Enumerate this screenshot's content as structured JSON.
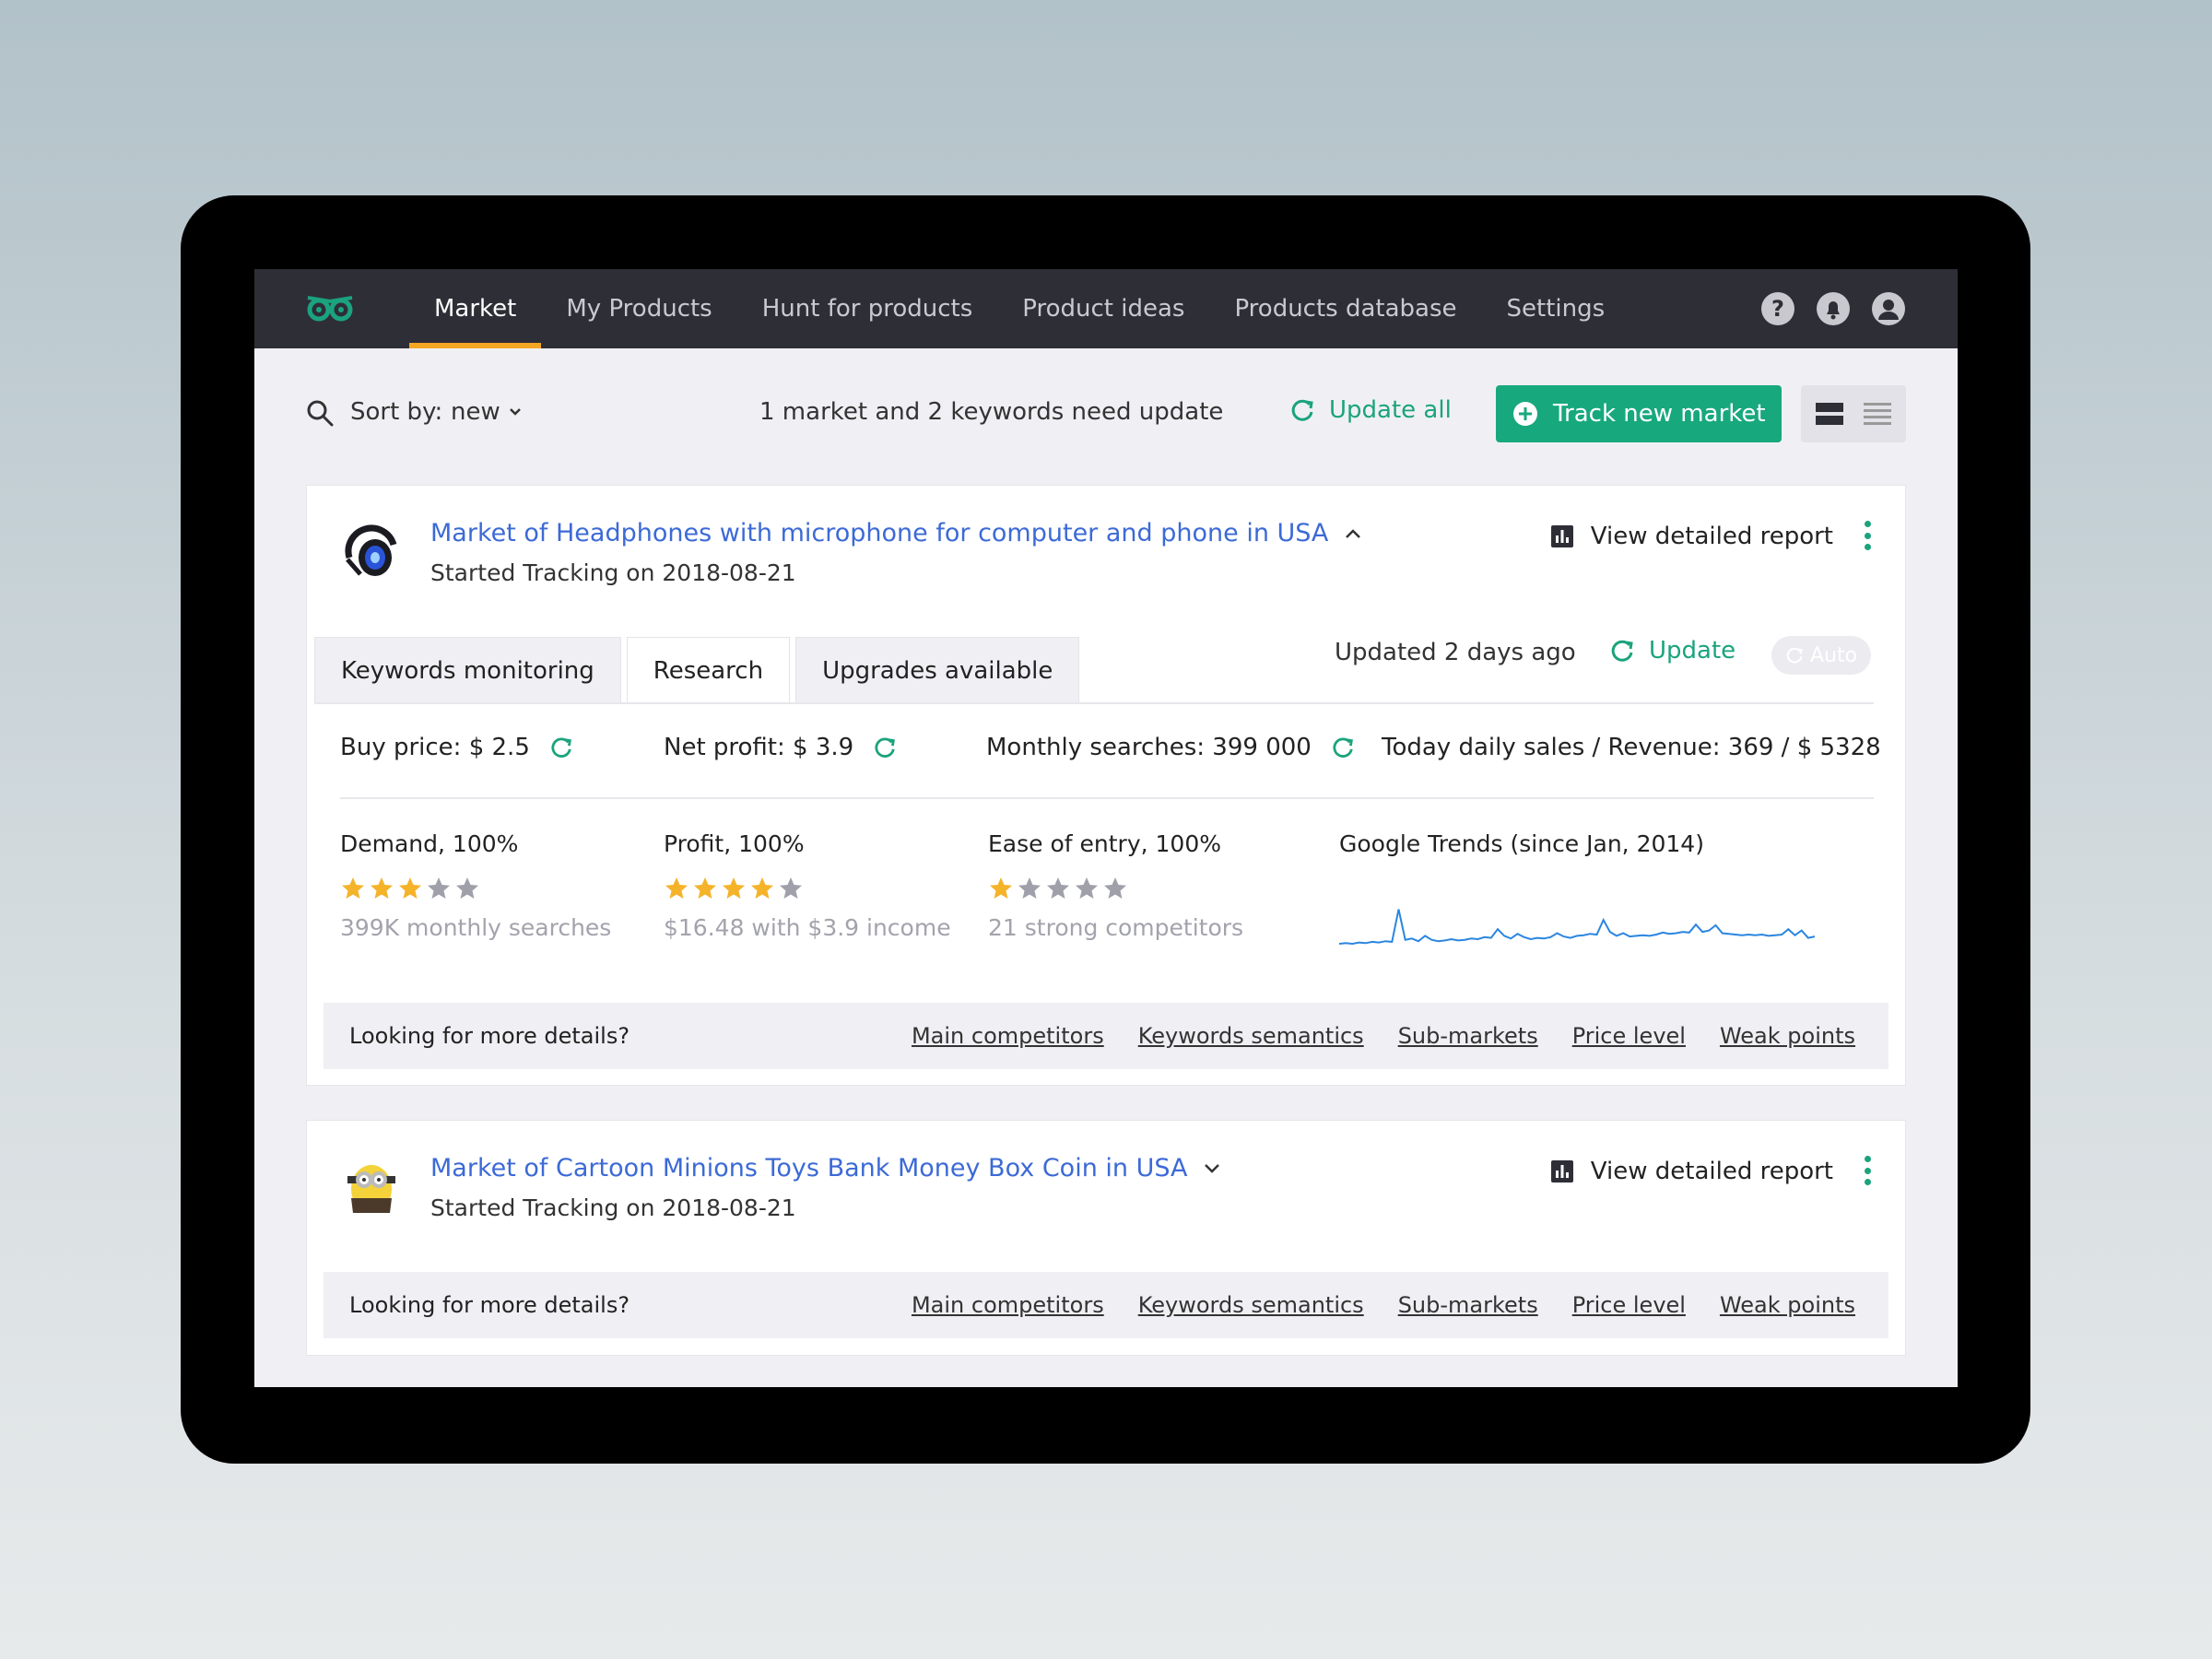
{
  "nav": {
    "items": [
      {
        "label": "Market",
        "active": true
      },
      {
        "label": "My Products"
      },
      {
        "label": "Hunt for products"
      },
      {
        "label": "Product ideas"
      },
      {
        "label": "Products database"
      },
      {
        "label": "Settings"
      }
    ],
    "icons": [
      "help-icon",
      "bell-icon",
      "user-icon"
    ]
  },
  "toolbar": {
    "sort_label": "Sort by:",
    "sort_value": "new",
    "need_update": "1 market and 2 keywords need update",
    "update_all": "Update all",
    "track_new": "Track new market"
  },
  "colors": {
    "accent": "#18a87e",
    "link": "#3c6ad6",
    "nav_bg": "#2e2e37",
    "tab_indicator": "#f5a623",
    "star": "#f5b32a",
    "star_off": "#a0a0aa"
  },
  "markets": [
    {
      "title": "Market of Headphones with microphone for computer and phone in USA",
      "started": "Started Tracking on 2018-08-21",
      "report": "View detailed report",
      "tabs": [
        "Keywords monitoring",
        "Research",
        "Upgrades available"
      ],
      "active_tab": "Research",
      "updated": "Updated 2 days ago",
      "update": "Update",
      "auto": "Auto",
      "metrics": {
        "buy_price": "Buy price: $ 2.5",
        "net_profit": "Net profit: $ 3.9",
        "monthly_searches": "Monthly searches: 399 000",
        "daily_sales": "Today daily sales / Revenue: 369 / $ 5328"
      },
      "scores": [
        {
          "label": "Demand, 100%",
          "stars": 3,
          "note": "399K monthly searches"
        },
        {
          "label": "Profit, 100%",
          "stars": 4,
          "note": "$16.48 with $3.9 income"
        },
        {
          "label": "Ease of entry, 100%",
          "stars": 1,
          "note": "21 strong competitors"
        }
      ],
      "trends_label": "Google Trends (since Jan, 2014)"
    },
    {
      "title": "Market of Cartoon Minions Toys Bank Money Box Coin in USA",
      "started": "Started Tracking on 2018-08-21",
      "report": "View detailed report"
    }
  ],
  "details": {
    "question": "Looking for more details?",
    "links": [
      "Main competitors",
      "Keywords semantics",
      "Sub-markets",
      "Price level",
      "Weak points"
    ]
  },
  "chart_data": {
    "type": "line",
    "title": "",
    "xlabel": "",
    "ylabel": "",
    "values": [
      18,
      19,
      18,
      20,
      19,
      21,
      20,
      22,
      21,
      70,
      24,
      26,
      22,
      30,
      24,
      22,
      23,
      25,
      23,
      24,
      26,
      25,
      28,
      27,
      40,
      30,
      26,
      33,
      28,
      25,
      27,
      26,
      28,
      34,
      29,
      27,
      30,
      31,
      33,
      32,
      54,
      36,
      30,
      34,
      29,
      30,
      31,
      30,
      32,
      35,
      33,
      34,
      36,
      35,
      47,
      36,
      38,
      46,
      34,
      33,
      32,
      31,
      32,
      31,
      32,
      30,
      31,
      32,
      40,
      31,
      38,
      27,
      29
    ],
    "ylim": [
      0,
      100
    ],
    "grid": false
  }
}
